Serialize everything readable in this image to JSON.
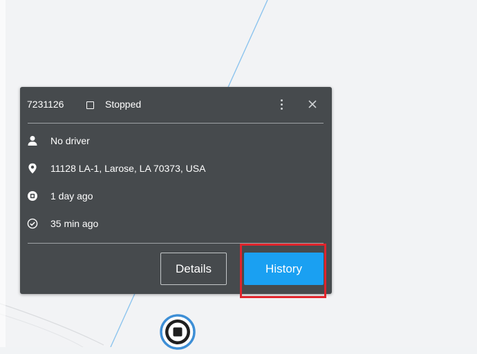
{
  "vehicle": {
    "id": "7231126",
    "status": "Stopped"
  },
  "details": {
    "driver": "No driver",
    "address": "11128 LA-1, Larose, LA 70373, USA",
    "stopped_for": "1 day ago",
    "last_update": "35 min ago"
  },
  "actions": {
    "details_label": "Details",
    "history_label": "History"
  },
  "icons": {
    "menu": "more-vertical-icon",
    "close": "close-icon",
    "driver": "person-icon",
    "address": "location-pin-icon",
    "stopped": "stop-circle-icon",
    "updated": "check-circle-icon",
    "marker": "stopped-vehicle-marker-icon"
  },
  "colors": {
    "popup_bg": "#464a4d",
    "history_button": "#1aa0f2",
    "highlight": "#e0242c",
    "map_route": "#8cc4ee"
  }
}
